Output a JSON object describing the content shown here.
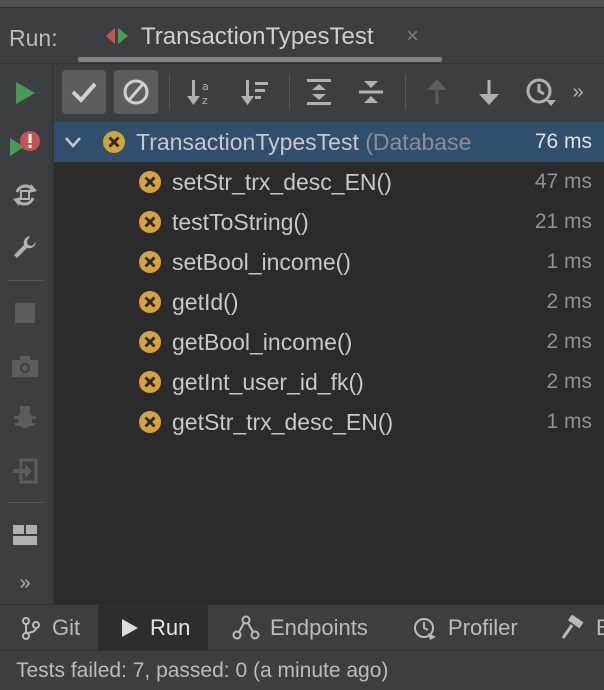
{
  "run_panel": {
    "label": "Run:",
    "tab_title": "TransactionTypesTest",
    "tab_close": "×"
  },
  "left_toolbar": {
    "items": [
      "rerun-icon",
      "rerun-failed-icon",
      "toggle-auto-test-icon",
      "wrench-icon",
      "stop-icon",
      "camera-icon",
      "debug-icon",
      "exit-icon",
      "layout-icon",
      "more-icon"
    ],
    "more_glyph": "»"
  },
  "test_toolbar": {
    "items": [
      "show-passed-icon",
      "show-ignored-icon",
      "sort-alpha-icon",
      "sort-duration-icon",
      "expand-all-icon",
      "collapse-all-icon",
      "previous-failed-icon",
      "next-failed-icon",
      "test-history-icon",
      "more-icon"
    ],
    "more_glyph": "»"
  },
  "test_tree": {
    "root": {
      "name": "TransactionTypesTest",
      "detail": "(Database",
      "time": "76 ms",
      "status": "failed"
    },
    "tests": [
      {
        "name": "setStr_trx_desc_EN()",
        "time": "47 ms",
        "status": "failed"
      },
      {
        "name": "testToString()",
        "time": "21 ms",
        "status": "failed"
      },
      {
        "name": "setBool_income()",
        "time": "1 ms",
        "status": "failed"
      },
      {
        "name": "getId()",
        "time": "2 ms",
        "status": "failed"
      },
      {
        "name": "getBool_income()",
        "time": "2 ms",
        "status": "failed"
      },
      {
        "name": "getInt_user_id_fk()",
        "time": "2 ms",
        "status": "failed"
      },
      {
        "name": "getStr_trx_desc_EN()",
        "time": "1 ms",
        "status": "failed"
      }
    ]
  },
  "bottom_tabs": [
    {
      "label": "Git",
      "icon": "git-branch-icon"
    },
    {
      "label": "Run",
      "icon": "run-icon",
      "active": true
    },
    {
      "label": "Endpoints",
      "icon": "endpoints-icon"
    },
    {
      "label": "Profiler",
      "icon": "profiler-icon"
    },
    {
      "label": "B",
      "icon": "build-icon"
    }
  ],
  "status_bar": {
    "text": "Tests failed: 7, passed: 0 (a minute ago)"
  },
  "colors": {
    "failed": "#d3a43a",
    "run_green": "#499c54",
    "error_red": "#c75450",
    "selection": "#2f4f6d"
  }
}
